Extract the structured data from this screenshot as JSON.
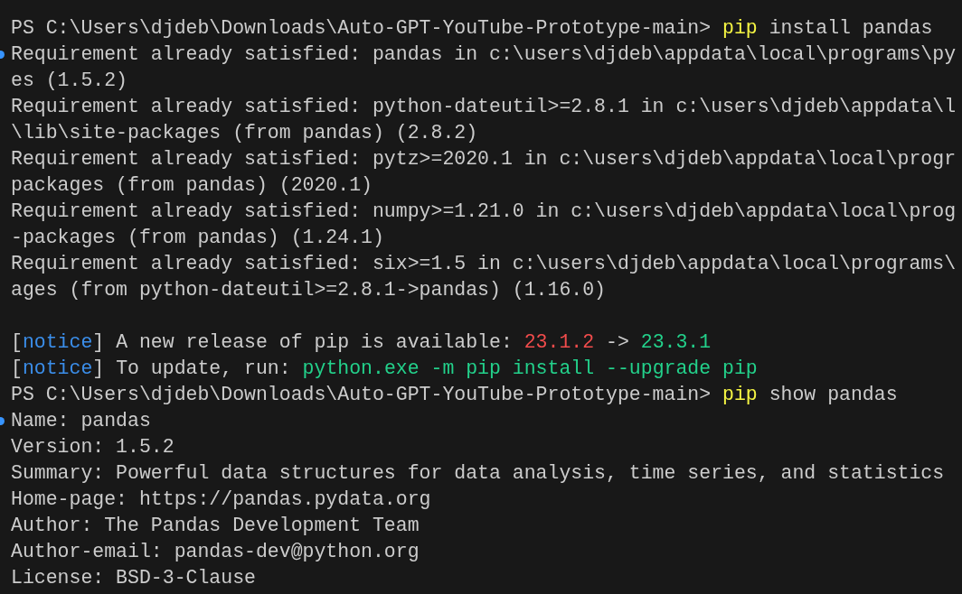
{
  "terminal": {
    "lines": [
      {
        "kind": "text",
        "marker": false,
        "segments": [
          {
            "kind": "plain",
            "text": "PS C:\\Users\\djdeb\\Downloads\\Auto-GPT-YouTube-Prototype-main> "
          },
          {
            "kind": "command",
            "text": "pip"
          },
          {
            "kind": "plain",
            "text": " install pandas"
          }
        ]
      },
      {
        "kind": "text",
        "marker": true,
        "segments": [
          {
            "kind": "plain",
            "text": "Requirement already satisfied: pandas in c:\\users\\djdeb\\appdata\\local\\programs\\py"
          }
        ]
      },
      {
        "kind": "text",
        "marker": false,
        "segments": [
          {
            "kind": "plain",
            "text": "es (1.5.2)"
          }
        ]
      },
      {
        "kind": "text",
        "marker": false,
        "segments": [
          {
            "kind": "plain",
            "text": "Requirement already satisfied: python-dateutil>=2.8.1 in c:\\users\\djdeb\\appdata\\l"
          }
        ]
      },
      {
        "kind": "text",
        "marker": false,
        "segments": [
          {
            "kind": "plain",
            "text": "\\lib\\site-packages (from pandas) (2.8.2)"
          }
        ]
      },
      {
        "kind": "text",
        "marker": false,
        "segments": [
          {
            "kind": "plain",
            "text": "Requirement already satisfied: pytz>=2020.1 in c:\\users\\djdeb\\appdata\\local\\progr"
          }
        ]
      },
      {
        "kind": "text",
        "marker": false,
        "segments": [
          {
            "kind": "plain",
            "text": "packages (from pandas) (2020.1)"
          }
        ]
      },
      {
        "kind": "text",
        "marker": false,
        "segments": [
          {
            "kind": "plain",
            "text": "Requirement already satisfied: numpy>=1.21.0 in c:\\users\\djdeb\\appdata\\local\\prog"
          }
        ]
      },
      {
        "kind": "text",
        "marker": false,
        "segments": [
          {
            "kind": "plain",
            "text": "-packages (from pandas) (1.24.1)"
          }
        ]
      },
      {
        "kind": "text",
        "marker": false,
        "segments": [
          {
            "kind": "plain",
            "text": "Requirement already satisfied: six>=1.5 in c:\\users\\djdeb\\appdata\\local\\programs\\"
          }
        ]
      },
      {
        "kind": "text",
        "marker": false,
        "segments": [
          {
            "kind": "plain",
            "text": "ages (from python-dateutil>=2.8.1->pandas) (1.16.0)"
          }
        ]
      },
      {
        "kind": "blank"
      },
      {
        "kind": "text",
        "marker": false,
        "segments": [
          {
            "kind": "plain",
            "text": "["
          },
          {
            "kind": "notice",
            "text": "notice"
          },
          {
            "kind": "plain",
            "text": "] A new release of pip is available: "
          },
          {
            "kind": "old",
            "text": "23.1.2"
          },
          {
            "kind": "plain",
            "text": " -> "
          },
          {
            "kind": "new",
            "text": "23.3.1"
          }
        ]
      },
      {
        "kind": "text",
        "marker": false,
        "segments": [
          {
            "kind": "plain",
            "text": "["
          },
          {
            "kind": "notice",
            "text": "notice"
          },
          {
            "kind": "plain",
            "text": "] To update, run: "
          },
          {
            "kind": "new",
            "text": "python.exe -m pip install --upgrade pip"
          }
        ]
      },
      {
        "kind": "text",
        "marker": false,
        "segments": [
          {
            "kind": "plain",
            "text": "PS C:\\Users\\djdeb\\Downloads\\Auto-GPT-YouTube-Prototype-main> "
          },
          {
            "kind": "command",
            "text": "pip"
          },
          {
            "kind": "plain",
            "text": " show pandas"
          }
        ]
      },
      {
        "kind": "text",
        "marker": true,
        "segments": [
          {
            "kind": "plain",
            "text": "Name: pandas"
          }
        ]
      },
      {
        "kind": "text",
        "marker": false,
        "segments": [
          {
            "kind": "plain",
            "text": "Version: 1.5.2"
          }
        ]
      },
      {
        "kind": "text",
        "marker": false,
        "segments": [
          {
            "kind": "plain",
            "text": "Summary: Powerful data structures for data analysis, time series, and statistics"
          }
        ]
      },
      {
        "kind": "text",
        "marker": false,
        "segments": [
          {
            "kind": "plain",
            "text": "Home-page: https://pandas.pydata.org"
          }
        ]
      },
      {
        "kind": "text",
        "marker": false,
        "segments": [
          {
            "kind": "plain",
            "text": "Author: The Pandas Development Team"
          }
        ]
      },
      {
        "kind": "text",
        "marker": false,
        "segments": [
          {
            "kind": "plain",
            "text": "Author-email: pandas-dev@python.org"
          }
        ]
      },
      {
        "kind": "text",
        "marker": false,
        "segments": [
          {
            "kind": "plain",
            "text": "License: BSD-3-Clause"
          }
        ]
      }
    ]
  }
}
